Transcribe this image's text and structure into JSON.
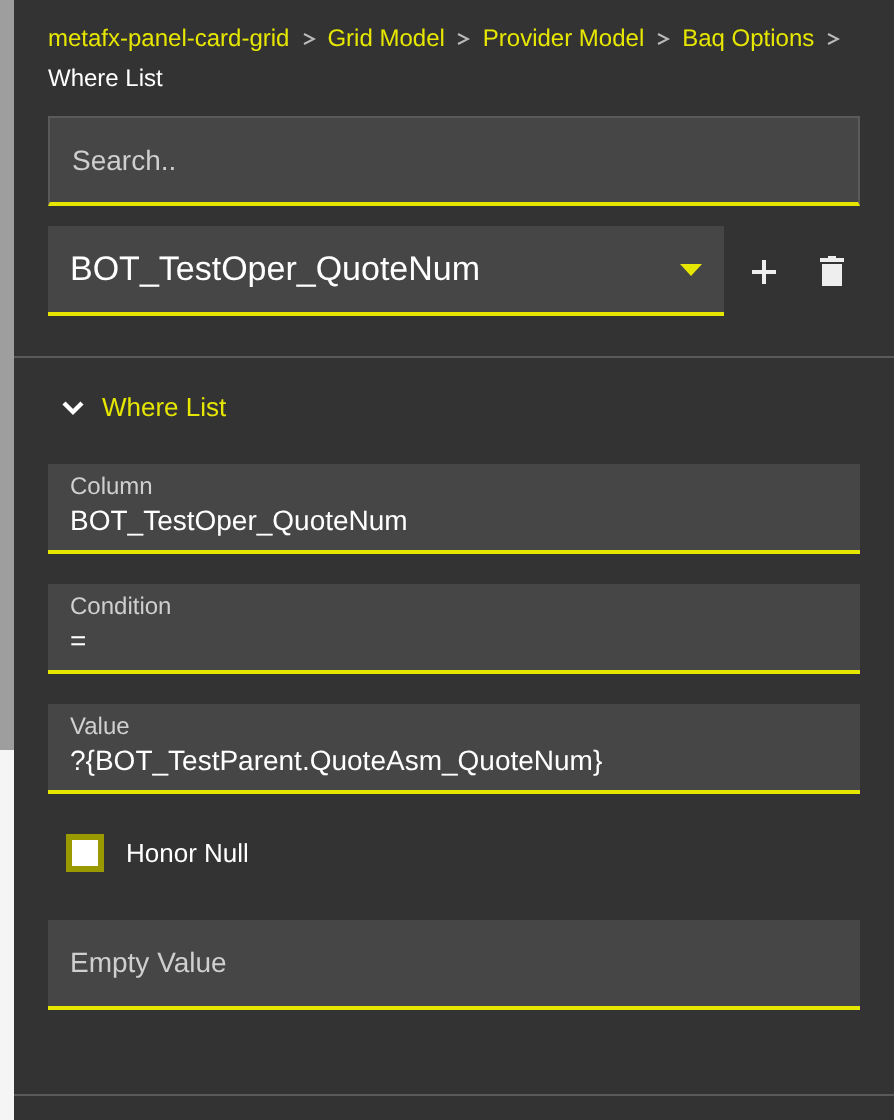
{
  "breadcrumb": [
    {
      "label": "metafx-panel-card-grid",
      "selected": false
    },
    {
      "label": "Grid Model",
      "selected": false
    },
    {
      "label": "Provider Model",
      "selected": false
    },
    {
      "label": "Baq Options",
      "selected": false
    },
    {
      "label": "Where List",
      "selected": true
    }
  ],
  "search": {
    "placeholder": "Search.."
  },
  "dropdown": {
    "value": "BOT_TestOper_QuoteNum"
  },
  "section": {
    "title": "Where List",
    "expanded": true
  },
  "fields": [
    {
      "kind": "text",
      "label": "Column",
      "value": "BOT_TestOper_QuoteNum"
    },
    {
      "kind": "text",
      "label": "Condition",
      "value": "="
    },
    {
      "kind": "text",
      "label": "Value",
      "value": "?{BOT_TestParent.QuoteAsm_QuoteNum}"
    },
    {
      "kind": "checkbox",
      "label": "Honor Null",
      "checked": false
    },
    {
      "kind": "empty",
      "placeholder": "Empty Value"
    }
  ]
}
